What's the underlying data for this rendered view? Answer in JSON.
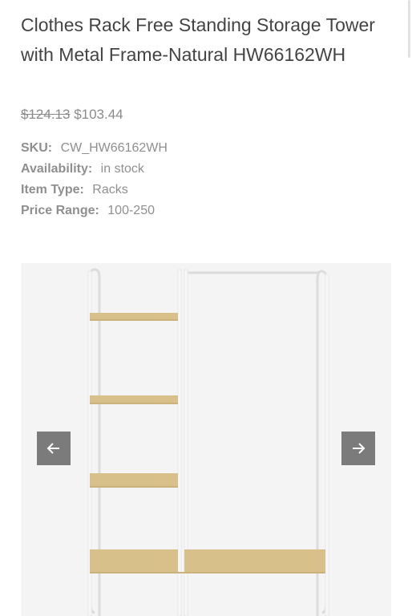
{
  "product": {
    "title": "Clothes Rack Free Standing Storage Tower with Metal Frame-Natural HW66162WH",
    "old_price": "$124.13",
    "new_price": "$103.44"
  },
  "specs": [
    {
      "label": "SKU:",
      "value": "CW_HW66162WH"
    },
    {
      "label": "Availability:",
      "value": "in stock"
    },
    {
      "label": "Item Type:",
      "value": "Racks"
    },
    {
      "label": "Price Range:",
      "value": "100-250"
    }
  ],
  "gallery": {
    "prev_icon": "arrow-left-icon",
    "next_icon": "arrow-right-icon"
  }
}
